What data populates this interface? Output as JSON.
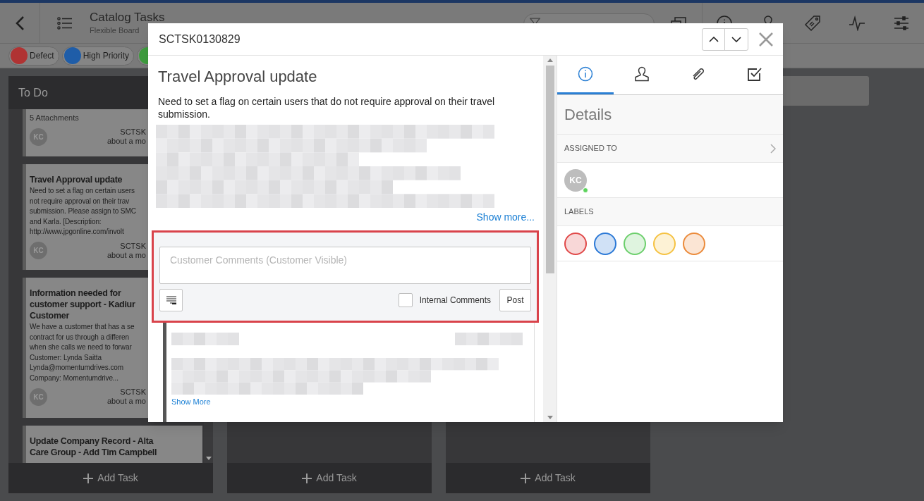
{
  "header": {
    "title": "Catalog Tasks",
    "subtitle": "Flexible Board"
  },
  "label_filters": [
    {
      "label": "Defect",
      "color": "#b03333"
    },
    {
      "label": "High Priority",
      "color": "#1f5da8"
    },
    {
      "color": "#3d9b3d"
    }
  ],
  "board": {
    "columns": [
      {
        "title": "To Do",
        "add_task": "Add Task",
        "cards": [
          {
            "attachments": "5 Attachments",
            "avatar": "KC",
            "number": "SCTSK",
            "time": "about a mo"
          },
          {
            "title": "Travel Approval update",
            "description": "Need to set a flag on certain users\nnot require approval on their trav\nsubmission. Please assign to SMC\nand Karla. [Description:\nhttp://www.jpgonline.com/involt",
            "avatar": "KC",
            "number": "SCTSK",
            "time": "about a mo"
          },
          {
            "title": "Information needed for\ncustomer support - Kadiur\nCustomer",
            "description": "We have a customer that has a se\ncontract for us through a differen\nwhen she calls we need to forwar\nCustomer: Lynda Saitta\nLynda@momentumdrives.com\nCompany: Momentumdrive...",
            "avatar": "KC",
            "number": "SCTSK",
            "time": "about a mo"
          },
          {
            "title": "Update Company Record - Alta\nCare Group - Add Tim Campbell"
          }
        ]
      },
      {
        "add_task": "Add Task"
      },
      {
        "add_task": "Add Task"
      }
    ]
  },
  "modal": {
    "number": "SCTSK0130829",
    "title": "Travel Approval update",
    "description": "Need to set a flag on certain users that do not require approval on their travel submission.",
    "show_more": "Show more...",
    "comment": {
      "placeholder": "Customer Comments (Customer Visible)",
      "internal": {
        "label": "Internal Comments",
        "checked": false
      },
      "post": "Post"
    },
    "activity": {
      "show_more": "Show More"
    },
    "tabs": [
      {
        "kind": "info",
        "selected": true
      },
      {
        "kind": "person",
        "selected": false
      },
      {
        "kind": "attachment",
        "selected": false
      },
      {
        "kind": "checklist",
        "selected": false
      }
    ],
    "details": {
      "title": "Details",
      "assigned_label": "ASSIGNED TO",
      "assignee": {
        "initials": "KC",
        "online": true
      },
      "labels_label": "LABELS",
      "labels": [
        {
          "color": "#e04848"
        },
        {
          "color": "#2a78d6"
        },
        {
          "color": "#6ccf6c"
        },
        {
          "color": "#f5c242"
        },
        {
          "color": "#eb8a3a"
        }
      ]
    }
  }
}
